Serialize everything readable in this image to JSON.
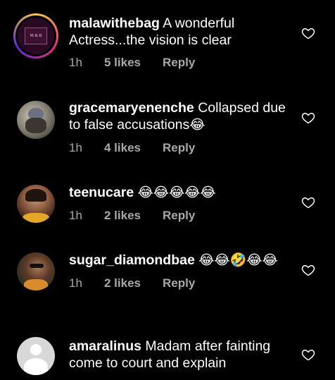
{
  "comments": [
    {
      "username": "malawithebag",
      "text": "A wonderful Actress...the vision is clear",
      "emoji": "",
      "time": "1h",
      "likes": "5 likes",
      "reply": "Reply",
      "avatar_text": "M & B",
      "avatar_ring": "#d62976"
    },
    {
      "username": "gracemaryenenche",
      "text": "Collapsed due to false accusations",
      "emoji": "😂",
      "time": "1h",
      "likes": "4 likes",
      "reply": "Reply"
    },
    {
      "username": "teenucare",
      "text": "",
      "emoji": "😂😂😂😂😂",
      "time": "1h",
      "likes": "2 likes",
      "reply": "Reply"
    },
    {
      "username": "sugar_diamondbae",
      "text": "",
      "emoji": "😂😂🤣😂😂",
      "time": "1h",
      "likes": "2 likes",
      "reply": "Reply"
    },
    {
      "username": "amaralinus",
      "text": "Madam after fainting come to court and explain",
      "emoji": "",
      "time": "",
      "likes": "",
      "reply": ""
    }
  ],
  "icons": {
    "like": "heart-icon"
  },
  "colors": {
    "background": "#000000",
    "meta_text": "#a8a8a8",
    "text": "#ffffff"
  }
}
